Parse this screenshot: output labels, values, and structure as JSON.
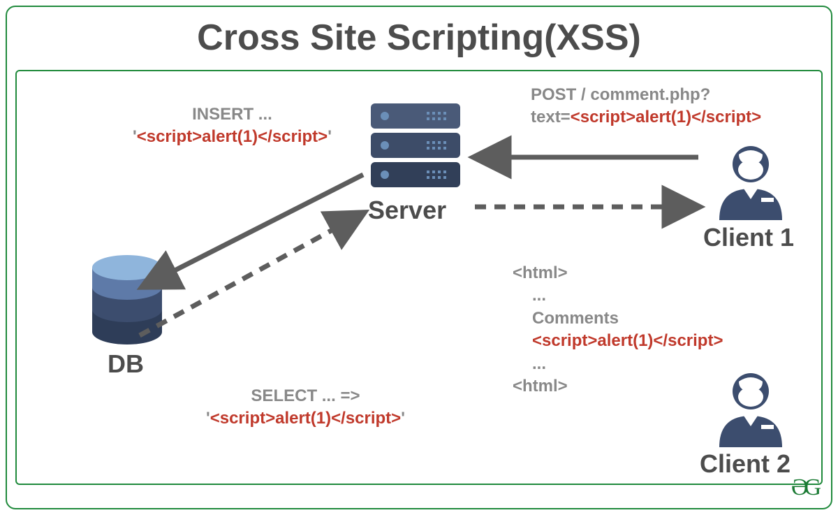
{
  "title": "Cross Site Scripting(XSS)",
  "labels": {
    "server": "Server",
    "db": "DB",
    "client1": "Client 1",
    "client2": "Client 2"
  },
  "post": {
    "line1": "POST / comment.php?",
    "prefix": "text=",
    "payload": "<script>alert(1)</script>"
  },
  "insert": {
    "line1": "INSERT ...",
    "q1": "'",
    "payload": "<script>alert(1)</script>",
    "q2": "'"
  },
  "select": {
    "line1": "SELECT ... =>",
    "q1": "'",
    "payload": "<script>alert(1)</script>",
    "q2": "'"
  },
  "html": {
    "open": "<html>",
    "dots1": "...",
    "comments": "Comments",
    "payload": "<script>alert(1)</script>",
    "dots2": "...",
    "close": "<html>"
  },
  "logo": "ƏG"
}
